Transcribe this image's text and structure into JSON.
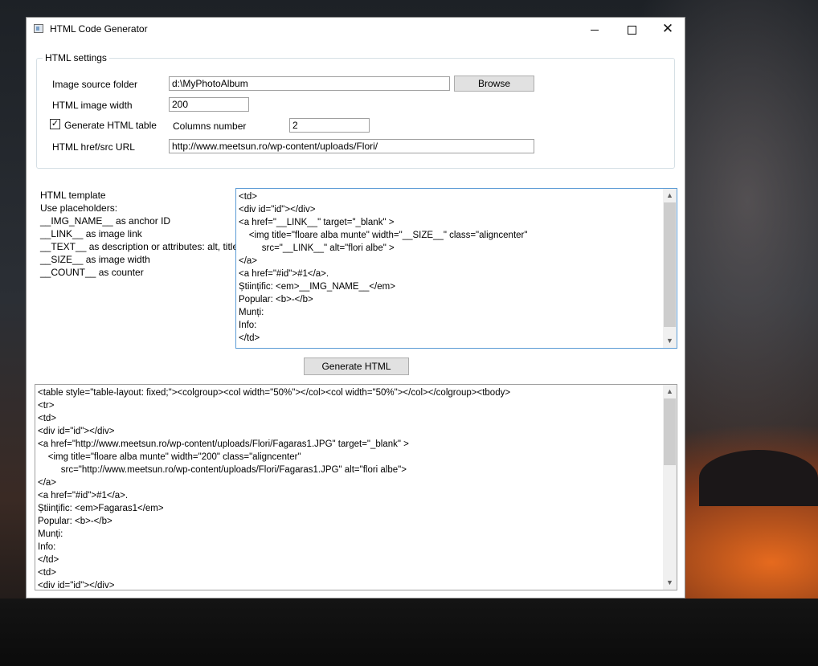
{
  "window": {
    "title": "HTML Code Generator",
    "minimize_symbol": "",
    "close_symbol": "✕"
  },
  "settings": {
    "group_title": "HTML settings",
    "image_source_label": "Image source folder",
    "image_source_value": "d:\\MyPhotoAlbum",
    "browse_label": "Browse",
    "image_width_label": "HTML image width",
    "image_width_value": "200",
    "generate_table_label": "Generate HTML table",
    "generate_table_checked": true,
    "check_mark": "✓",
    "columns_label": "Columns number",
    "columns_value": "2",
    "href_label": "HTML href/src URL",
    "href_value": "http://www.meetsun.ro/wp-content/uploads/Flori/"
  },
  "template_help": [
    "HTML template",
    "Use placeholders:",
    "__IMG_NAME__ as anchor ID",
    "__LINK__ as image link",
    "__TEXT__ as description or attributes: alt, title",
    "__SIZE__ as image width",
    "__COUNT__ as counter"
  ],
  "template_text": "<td>\n<div id=\"id\"></div>\n<a href=\"__LINK__\" target=\"_blank\" >\n    <img title=\"floare alba munte\" width=\"__SIZE__\" class=\"aligncenter\"\n         src=\"__LINK__\" alt=\"flori albe\" >\n</a>\n<a href=\"#id\">#1</a>.\nȘtiințific: <em>__IMG_NAME__</em>\nPopular: <b>-</b>\nMunți:\nInfo:\n</td>",
  "generate_button_label": "Generate HTML",
  "output_text": "<table style=\"table-layout: fixed;\"><colgroup><col width=\"50%\"></col><col width=\"50%\"></col></colgroup><tbody>\n<tr>\n<td>\n<div id=\"id\"></div>\n<a href=\"http://www.meetsun.ro/wp-content/uploads/Flori/Fagaras1.JPG\" target=\"_blank\" >\n    <img title=\"floare alba munte\" width=\"200\" class=\"aligncenter\"\n         src=\"http://www.meetsun.ro/wp-content/uploads/Flori/Fagaras1.JPG\" alt=\"flori albe\">\n</a>\n<a href=\"#id\">#1</a>.\nȘtiințific: <em>Fagaras1</em>\nPopular: <b>-</b>\nMunți:\nInfo:\n</td>\n<td>\n<div id=\"id\"></div>",
  "scroll_icons": {
    "up": "▲",
    "down": "▼"
  }
}
